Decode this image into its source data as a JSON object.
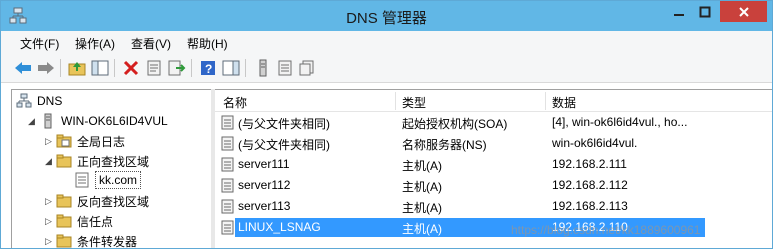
{
  "window": {
    "title": "DNS 管理器",
    "title_bar_color": "#61b7e6",
    "close_color": "#c9413c"
  },
  "menu": [
    {
      "label": "文件(F)"
    },
    {
      "label": "操作(A)"
    },
    {
      "label": "查看(V)"
    },
    {
      "label": "帮助(H)"
    }
  ],
  "toolbar": [
    {
      "icon": "back-arrow-icon"
    },
    {
      "icon": "forward-arrow-icon"
    },
    {
      "icon": "up-folder-icon"
    },
    {
      "icon": "show-hide-tree-icon"
    },
    {
      "icon": "delete-icon"
    },
    {
      "icon": "properties-icon"
    },
    {
      "icon": "export-list-icon"
    },
    {
      "icon": "help-icon"
    },
    {
      "icon": "action-pane-icon"
    },
    {
      "icon": "server-icon"
    },
    {
      "icon": "record-icon"
    },
    {
      "icon": "copy-record-icon"
    }
  ],
  "tree": [
    {
      "label": "DNS",
      "icon": "dns-icon",
      "expander": "",
      "level": 0
    },
    {
      "label": "WIN-OK6L6ID4VUL",
      "icon": "server-icon",
      "expander": "◢",
      "level": 1
    },
    {
      "label": "全局日志",
      "icon": "log-folder-icon",
      "expander": "▷",
      "level": 2
    },
    {
      "label": "正向查找区域",
      "icon": "folder-icon",
      "expander": "◢",
      "level": 2
    },
    {
      "label": "kk.com",
      "icon": "zone-icon",
      "expander": "",
      "level": 3,
      "selected": true
    },
    {
      "label": "反向查找区域",
      "icon": "folder-icon",
      "expander": "▷",
      "level": 2
    },
    {
      "label": "信任点",
      "icon": "folder-icon",
      "expander": "▷",
      "level": 2
    },
    {
      "label": "条件转发器",
      "icon": "folder-icon",
      "expander": "▷",
      "level": 2
    }
  ],
  "list": {
    "columns": [
      "名称",
      "类型",
      "数据"
    ],
    "rows": [
      {
        "name": "(与父文件夹相同)",
        "type": "起始授权机构(SOA)",
        "data": "[4], win-ok6l6id4vul., ho..."
      },
      {
        "name": "(与父文件夹相同)",
        "type": "名称服务器(NS)",
        "data": "win-ok6l6id4vul."
      },
      {
        "name": "server111",
        "type": "主机(A)",
        "data": "192.168.2.111"
      },
      {
        "name": "server112",
        "type": "主机(A)",
        "data": "192.168.2.112"
      },
      {
        "name": "server113",
        "type": "主机(A)",
        "data": "192.168.2.113"
      },
      {
        "name": "LINUX_LSNAG",
        "type": "主机(A)",
        "data": "192.168.2.110",
        "selected": true
      }
    ]
  },
  "watermark": "https://blog.csdn.net/kk1889600961"
}
